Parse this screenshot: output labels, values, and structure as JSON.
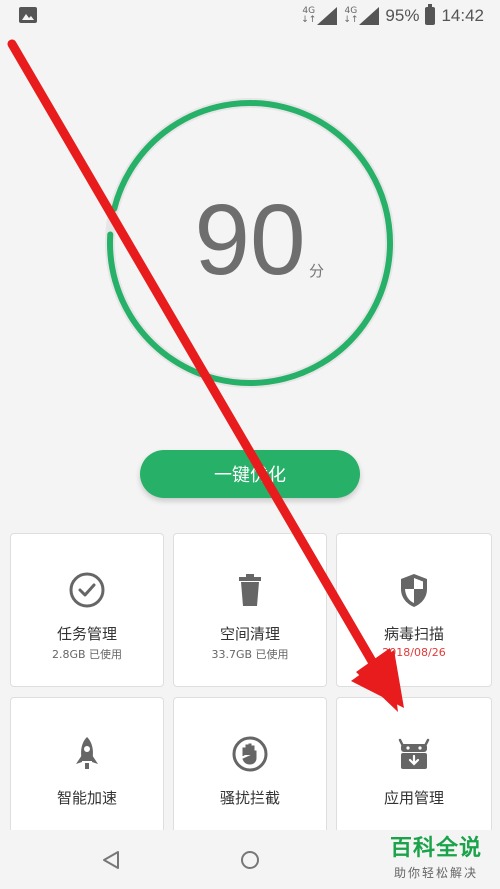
{
  "status_bar": {
    "network_1": "4G",
    "network_2": "4G",
    "battery": "95%",
    "time": "14:42",
    "icons": [
      "image-icon",
      "signal-icon",
      "signal-icon",
      "battery-icon"
    ]
  },
  "score": {
    "value": "90",
    "unit": "分",
    "progress": 0.97,
    "ring_color": "#27b068",
    "track_color": "#e6e6e6"
  },
  "optimize_button": {
    "label": "一键优化",
    "color": "#27b068"
  },
  "tools": [
    {
      "title": "任务管理",
      "sub": "2.8GB 已使用",
      "icon": "check-circle-icon"
    },
    {
      "title": "空间清理",
      "sub": "33.7GB 已使用",
      "icon": "trash-icon"
    },
    {
      "title": "病毒扫描",
      "sub": "2018/08/26",
      "icon": "shield-icon",
      "sub_color": "#e23a3a"
    },
    {
      "title": "智能加速",
      "sub": "",
      "icon": "rocket-icon"
    },
    {
      "title": "骚扰拦截",
      "sub": "",
      "icon": "hand-block-icon"
    },
    {
      "title": "应用管理",
      "sub": "",
      "icon": "android-box-icon"
    }
  ],
  "navigation": {
    "icons": [
      "back-icon",
      "home-icon"
    ]
  },
  "watermark": {
    "title": "百科全说",
    "subtitle": "助你轻松解决"
  },
  "annotation": {
    "arrow_color": "#e81c1c"
  }
}
